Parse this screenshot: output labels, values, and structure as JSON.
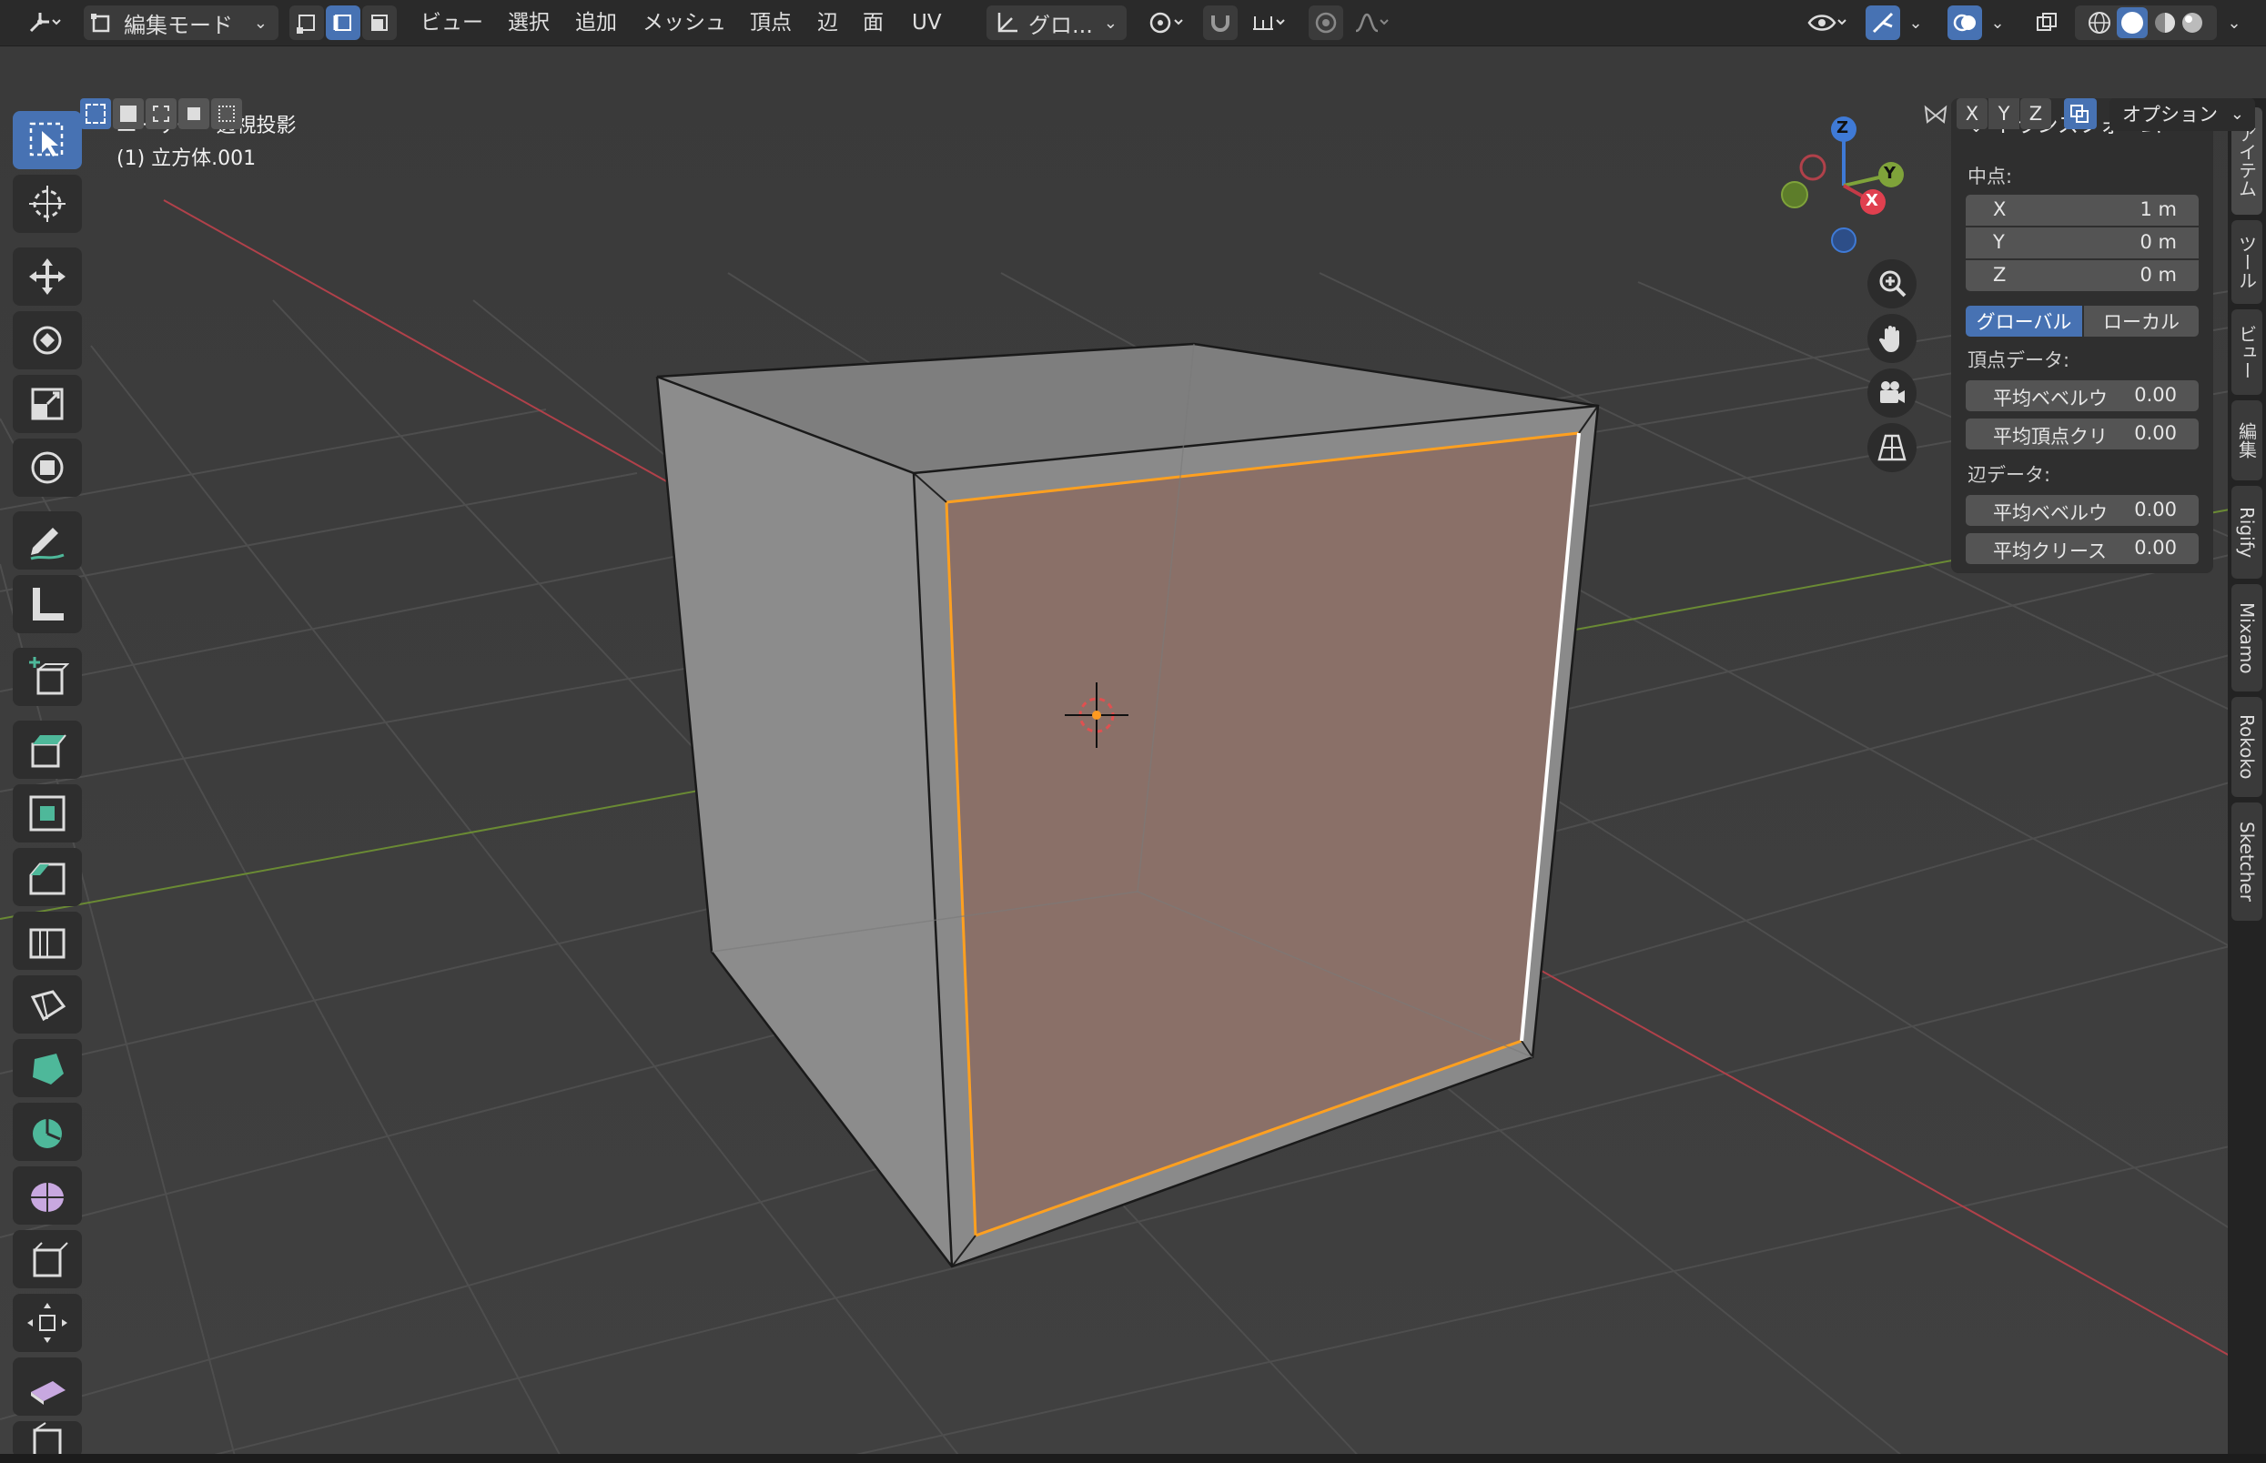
{
  "header": {
    "mode_label": "編集モード",
    "menus": [
      "ビュー",
      "選択",
      "追加",
      "メッシュ",
      "頂点",
      "辺",
      "面",
      "UV"
    ],
    "transform_orientation": "グロ...",
    "options_label": "オプション",
    "axis_labels": [
      "X",
      "Y",
      "Z"
    ]
  },
  "viewport": {
    "view_name": "ユーザー・透視投影",
    "object_name": "(1) 立方体.001"
  },
  "gizmo": {
    "x": "X",
    "y": "Y",
    "z": "Z"
  },
  "npanel": {
    "section_title": "トランスフォーム",
    "median_label": "中点:",
    "fields": [
      {
        "axis": "X",
        "value": "1 m"
      },
      {
        "axis": "Y",
        "value": "0 m"
      },
      {
        "axis": "Z",
        "value": "0 m"
      }
    ],
    "global_label": "グローバル",
    "local_label": "ローカル",
    "vertex_data_label": "頂点データ:",
    "vertex_fields": [
      {
        "label": "平均ベベルウ",
        "value": "0.00"
      },
      {
        "label": "平均頂点クリ",
        "value": "0.00"
      }
    ],
    "edge_data_label": "辺データ:",
    "edge_fields": [
      {
        "label": "平均ベベルウ",
        "value": "0.00"
      },
      {
        "label": "平均クリース",
        "value": "0.00"
      }
    ]
  },
  "side_tabs": [
    "アイテム",
    "ツール",
    "ビュー",
    "編集",
    "Rigify",
    "Mixamo",
    "Rokoko",
    "Sketcher"
  ],
  "colors": {
    "accent": "#4772b3",
    "selected_face": "#8a6f63",
    "selected_edge": "#ffa020",
    "x_axis": "#c43a47",
    "y_axis": "#7fa33a",
    "z_axis": "#3f7ad6"
  }
}
